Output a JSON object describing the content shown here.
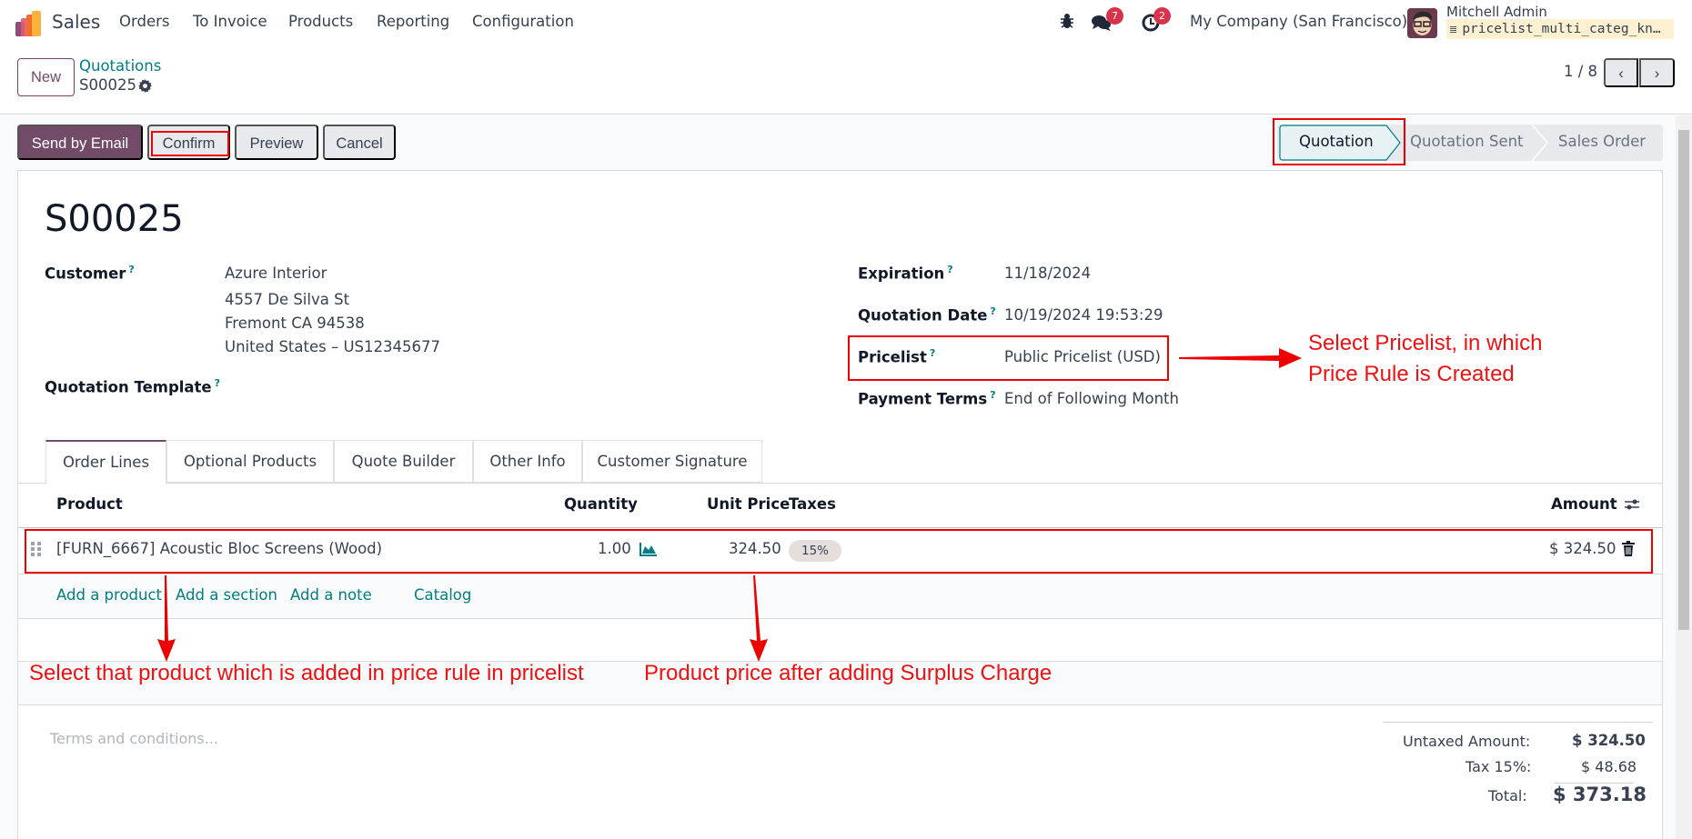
{
  "navbar": {
    "app_name": "Sales",
    "menu": [
      "Orders",
      "To Invoice",
      "Products",
      "Reporting",
      "Configuration"
    ],
    "icons": {
      "debug": "bug-icon",
      "messages": "chat-icon",
      "activities": "clock-icon"
    },
    "messages_count": "7",
    "activities_count": "2",
    "company": "My Company (San Francisco)",
    "user_name": "Mitchell Admin",
    "database": "pricelist_multi_categ_kn…"
  },
  "control_panel": {
    "new_label": "New",
    "breadcrumb_parent": "Quotations",
    "breadcrumb_current": "S00025",
    "pager": "1 / 8"
  },
  "actions": {
    "send_email": "Send by Email",
    "confirm": "Confirm",
    "preview": "Preview",
    "cancel": "Cancel"
  },
  "statusbar": {
    "stages": [
      "Quotation",
      "Quotation Sent",
      "Sales Order"
    ],
    "active": "Quotation"
  },
  "form": {
    "title": "S00025",
    "customer_label": "Customer",
    "customer_name": "Azure Interior",
    "customer_address": [
      "4557 De Silva St",
      "Fremont CA 94538",
      "United States – US12345677"
    ],
    "template_label": "Quotation Template",
    "expiration_label": "Expiration",
    "expiration": "11/18/2024",
    "date_label": "Quotation Date",
    "date": "10/19/2024 19:53:29",
    "pricelist_label": "Pricelist",
    "pricelist": "Public Pricelist (USD)",
    "terms_label": "Payment Terms",
    "terms": "End of Following Month",
    "help": "?"
  },
  "tabs": [
    "Order Lines",
    "Optional Products",
    "Quote Builder",
    "Other Info",
    "Customer Signature"
  ],
  "order_lines": {
    "headers": {
      "product": "Product",
      "quantity": "Quantity",
      "unit_price": "Unit Price",
      "taxes": "Taxes",
      "amount": "Amount"
    },
    "rows": [
      {
        "product": "[FURN_6667] Acoustic Bloc Screens (Wood)",
        "quantity": "1.00",
        "unit_price": "324.50",
        "tax": "15%",
        "amount": "$ 324.50"
      }
    ],
    "add_product": "Add a product",
    "add_section": "Add a section",
    "add_note": "Add a note",
    "catalog": "Catalog"
  },
  "footer": {
    "terms_placeholder": "Terms and conditions...",
    "untaxed_label": "Untaxed Amount:",
    "untaxed": "$ 324.50",
    "tax_label": "Tax 15%:",
    "tax": "$ 48.68",
    "total_label": "Total:",
    "total": "$ 373.18"
  },
  "annotations": {
    "pricelist_note_1": "Select  Pricelist, in which",
    "pricelist_note_2": "Price Rule is Created",
    "product_note": "Select that product which is added in price rule in pricelist",
    "price_note": "Product price after adding Surplus Charge",
    "color": "#ee0000"
  }
}
